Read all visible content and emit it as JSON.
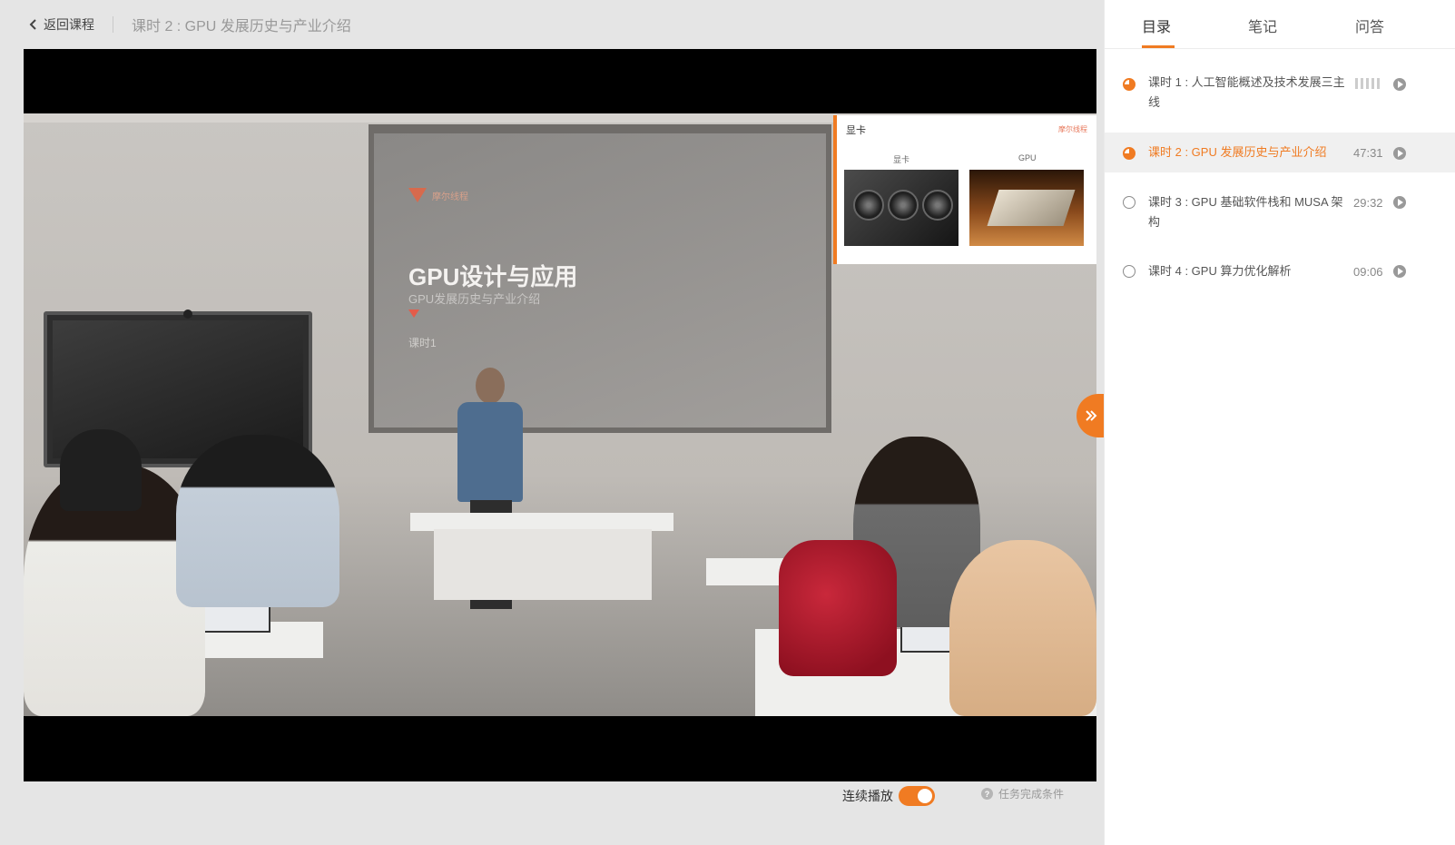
{
  "header": {
    "back_label": "返回课程",
    "lesson_title": "课时 2 : GPU 发展历史与产业介绍"
  },
  "video": {
    "slide": {
      "title": "GPU设计与应用",
      "subtitle": "GPU发展历史与产业介绍",
      "lesson": "课时1",
      "logo_text": "摩尔线程"
    },
    "inset": {
      "title": "显卡",
      "caption_left": "显卡",
      "caption_right": "GPU",
      "logo_text": "摩尔线程"
    }
  },
  "controls": {
    "autoplay_label": "连续播放",
    "autoplay_on": true,
    "task_label": "任务完成条件"
  },
  "sidebar": {
    "tabs": [
      {
        "label": "目录",
        "active": true
      },
      {
        "label": "笔记",
        "active": false
      },
      {
        "label": "问答",
        "active": false
      }
    ],
    "lessons": [
      {
        "name": "课时 1 : 人工智能概述及技术发展三主线",
        "duration": "",
        "status": "in-progress",
        "active": false
      },
      {
        "name": "课时 2 : GPU 发展历史与产业介绍",
        "duration": "47:31",
        "status": "in-progress",
        "active": true
      },
      {
        "name": "课时 3 : GPU 基础软件栈和 MUSA 架构",
        "duration": "29:32",
        "status": "not-started",
        "active": false
      },
      {
        "name": "课时 4 : GPU 算力优化解析",
        "duration": "09:06",
        "status": "not-started",
        "active": false
      }
    ]
  },
  "colors": {
    "accent": "#f07b22",
    "background": "#e5e5e5",
    "sidebar_bg": "#ffffff",
    "active_row_bg": "#f0f0f0"
  },
  "icons": {
    "back": "chevron-left-icon",
    "collapse": "double-chevron-right-icon",
    "help": "question-circle-icon",
    "play": "play-circle-icon"
  }
}
